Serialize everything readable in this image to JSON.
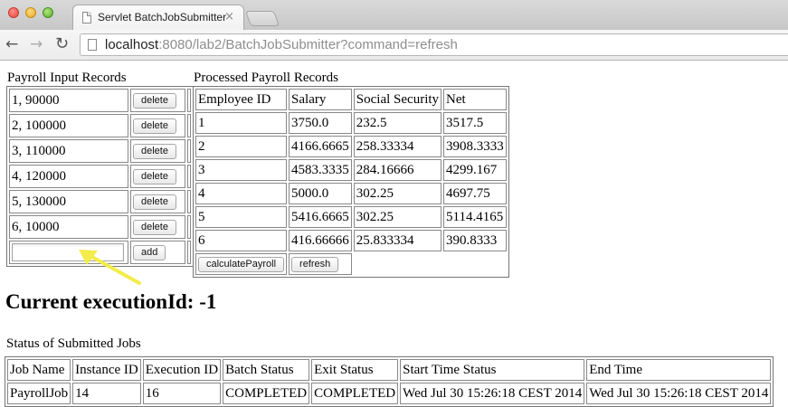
{
  "browser": {
    "tab_title": "Servlet BatchJobSubmitter",
    "tab_close": "×",
    "url_host": "localhost",
    "url_rest": ":8080/lab2/BatchJobSubmitter?command=refresh",
    "back_glyph": "←",
    "forward_glyph": "→",
    "reload_glyph": "↻"
  },
  "input": {
    "caption": "Payroll Input Records",
    "records": [
      {
        "text": "1, 90000",
        "action": "delete"
      },
      {
        "text": "2, 100000",
        "action": "delete"
      },
      {
        "text": "3, 110000",
        "action": "delete"
      },
      {
        "text": "4, 120000",
        "action": "delete"
      },
      {
        "text": "5, 130000",
        "action": "delete"
      },
      {
        "text": "6, 10000",
        "action": "delete"
      }
    ],
    "new_value": "",
    "add_label": "add"
  },
  "processed": {
    "caption": "Processed Payroll Records",
    "headers": [
      "Employee ID",
      "Salary",
      "Social Security",
      "Net"
    ],
    "rows": [
      [
        "1",
        "3750.0",
        "232.5",
        "3517.5"
      ],
      [
        "2",
        "4166.6665",
        "258.33334",
        "3908.3333"
      ],
      [
        "3",
        "4583.3335",
        "284.16666",
        "4299.167"
      ],
      [
        "4",
        "5000.0",
        "302.25",
        "4697.75"
      ],
      [
        "5",
        "5416.6665",
        "302.25",
        "5114.4165"
      ],
      [
        "6",
        "416.66666",
        "25.833334",
        "390.8333"
      ]
    ],
    "calculate_label": "calculatePayroll",
    "refresh_label": "refresh"
  },
  "execution": {
    "heading": "Current executionId: -1"
  },
  "jobs": {
    "caption": "Status of Submitted Jobs",
    "headers": [
      "Job Name",
      "Instance ID",
      "Execution ID",
      "Batch Status",
      "Exit Status",
      "Start Time Status",
      "End Time"
    ],
    "rows": [
      [
        "PayrollJob",
        "14",
        "16",
        "COMPLETED",
        "COMPLETED",
        "Wed Jul 30 15:26:18 CEST 2014",
        "Wed Jul 30 15:26:18 CEST 2014"
      ]
    ]
  },
  "colors": {
    "annotation_arrow": "#f3ec4a"
  }
}
